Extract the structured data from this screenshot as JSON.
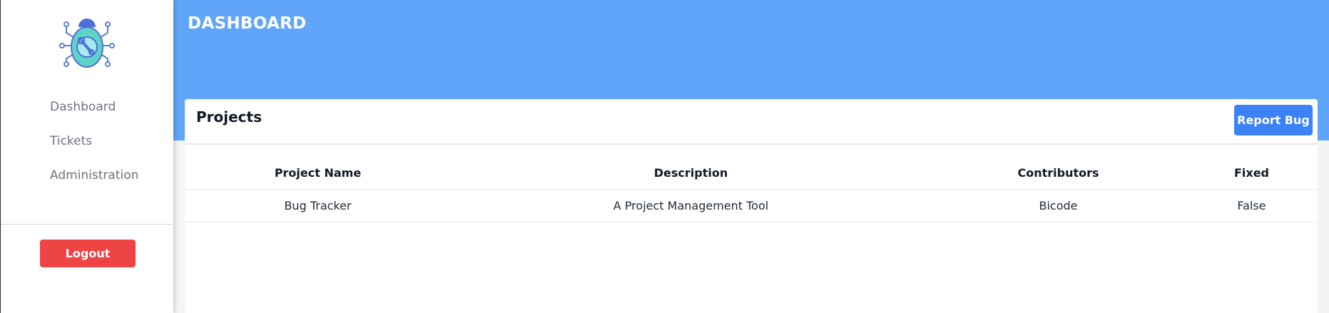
{
  "sidebar": {
    "logo_icon": "bug-wrench-logo",
    "items": [
      {
        "label": "Dashboard"
      },
      {
        "label": "Tickets"
      },
      {
        "label": "Administration"
      }
    ],
    "logout_label": "Logout"
  },
  "header": {
    "title": "DASHBOARD"
  },
  "projects": {
    "title": "Projects",
    "report_button": "Report Bug",
    "columns": [
      "Project Name",
      "Description",
      "Contributors",
      "Fixed"
    ],
    "rows": [
      [
        "Bug Tracker",
        "A Project Management Tool",
        "Bicode",
        "False"
      ]
    ]
  },
  "colors": {
    "header_bg": "#60a5fa",
    "primary_button": "#3b82f6",
    "logout_button": "#ef4444"
  }
}
